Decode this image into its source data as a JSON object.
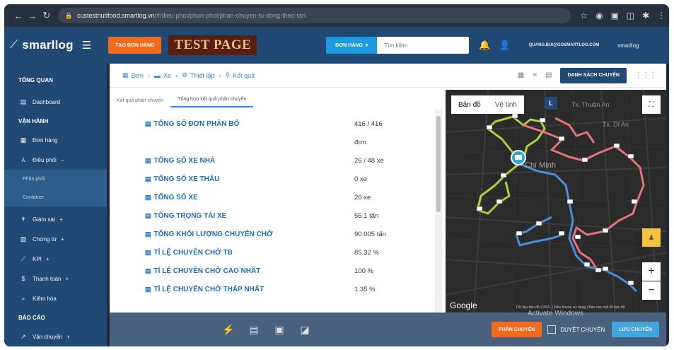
{
  "browser": {
    "url_host": "custestnutifood.smartlog.vn",
    "url_path": "/#/dieu-phoi/phan-phoi/phan-chuyen-tu-dong-theo-tan"
  },
  "header": {
    "logo": "smarllog",
    "create_order": "TẠO ĐƠN HÀNG",
    "test_banner": "TEST PAGE",
    "search_scope": "ĐƠN HÀNG",
    "search_placeholder": "Tìm kiếm",
    "user_email": "QUANG.BUI@GOSMARTLOG.COM",
    "brand": "smarllog"
  },
  "sidebar": {
    "overview": "TỔNG QUAN",
    "dashboard": "Dashboard",
    "operations": "VẬN HÀNH",
    "orders": "Đơn hàng",
    "dispatch": "Điều phối",
    "distribution": "Phân phối",
    "container": "Container",
    "monitoring": "Giám sát",
    "documents": "Chứng từ",
    "kpi": "KPI",
    "payment": "Thanh toán",
    "inspection": "Kiểm hóa",
    "reports": "BÁO CÁO",
    "transport": "Vận chuyển"
  },
  "breadcrumb": {
    "b1": "Đơn",
    "b2": "Xe",
    "b3": "Thiết lập",
    "b4": "Kết quả"
  },
  "toolbar": {
    "list_trips": "DANH SÁCH CHUYẾN"
  },
  "tabs": {
    "t1": "Kết quả phân chuyến",
    "t2": "Tổng hợp kết quả phân chuyến"
  },
  "stats": [
    {
      "label": "TỔNG SỐ ĐƠN PHÂN BỔ",
      "value": "416 / 416"
    },
    {
      "label": "",
      "value": "đơn"
    },
    {
      "label": "TỔNG SỐ XE NHÀ",
      "value": "26 / 48 xe"
    },
    {
      "label": "TỔNG SỐ XE THẦU",
      "value": "0 xe"
    },
    {
      "label": "TỔNG SỐ XE",
      "value": "26 xe"
    },
    {
      "label": "TỔNG TRỌNG TẢI XE",
      "value": "55.1 tấn"
    },
    {
      "label": "TỔNG KHỐI LƯỢNG CHUYÊN CHỞ",
      "value": "90.005 tấn"
    },
    {
      "label": "TỈ LỆ CHUYÊN CHỞ TB",
      "value": "85.32 %"
    },
    {
      "label": "TỈ LỆ CHUYÊN CHỞ CAO NHẤT",
      "value": "100 %"
    },
    {
      "label": "TỈ LỆ CHUYÊN CHỞ THẤP NHẤT",
      "value": "1.35 %"
    }
  ],
  "map": {
    "map_tab": "Bản đồ",
    "satellite_tab": "Vệ tinh",
    "city_label": "Chí Minh",
    "place1": "Tx. Thuận An",
    "place2": "Tx. Dĩ An",
    "google": "Google",
    "attribution": "Dữ liệu bản đồ ©2021 | Điều khoản sử dụng | Báo cáo một lỗi bản đồ",
    "route_colors": {
      "green": "#a8d13d",
      "pink": "#e8707f",
      "blue": "#4a90d9"
    }
  },
  "bottom": {
    "assign_trips": "PHÂN CHUYẾN",
    "approve_trips": "DUYỆT CHUYẾN",
    "save_trips": "LƯU CHUYẾN",
    "activate_watermark": "Activate Windows"
  }
}
